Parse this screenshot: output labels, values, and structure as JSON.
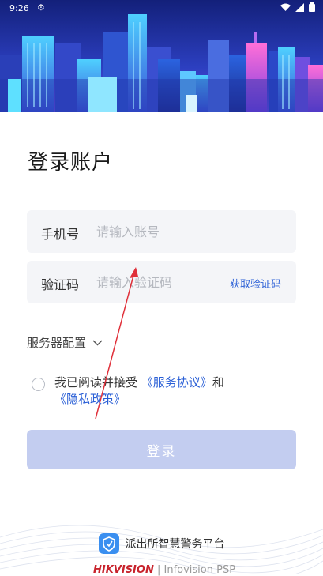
{
  "status": {
    "time": "9:26"
  },
  "page": {
    "title": "登录账户"
  },
  "phone_field": {
    "label": "手机号",
    "placeholder": "请输入账号"
  },
  "code_field": {
    "label": "验证码",
    "placeholder": "请输入验证码",
    "action": "获取验证码"
  },
  "server": {
    "label": "服务器配置"
  },
  "agreement": {
    "prefix": "我已阅读并接受",
    "service_link": "《服务协议》",
    "conjunction": "和",
    "privacy_link": "《隐私政策》"
  },
  "login": {
    "label": "登录",
    "color": "#c3cdf0"
  },
  "footer": {
    "platform_name": "派出所智慧警务平台",
    "brand": "HIKVISION",
    "product": "Infovision PSP"
  },
  "colors": {
    "accent": "#2a5fd6",
    "hero_top": "#1b2a8a",
    "hero_bottom": "#5a3fd8"
  }
}
